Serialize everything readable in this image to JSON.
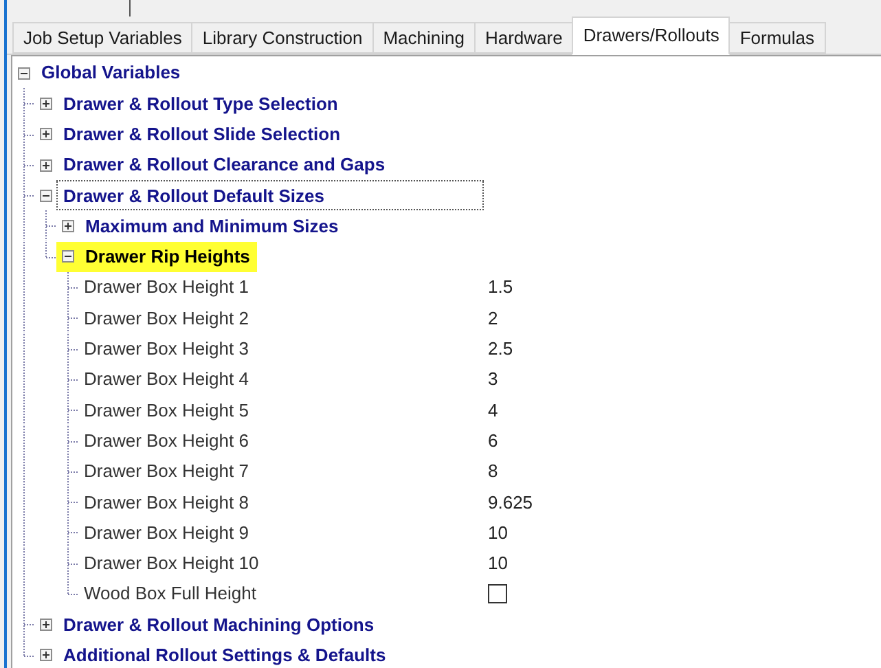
{
  "tabs": [
    {
      "label": "Job Setup Variables",
      "selected": false
    },
    {
      "label": "Library Construction",
      "selected": false
    },
    {
      "label": "Machining",
      "selected": false
    },
    {
      "label": "Hardware",
      "selected": false
    },
    {
      "label": "Drawers/Rollouts",
      "selected": true
    },
    {
      "label": "Formulas",
      "selected": false
    }
  ],
  "tree": [
    {
      "kind": "group",
      "label": "Global Variables",
      "expanded": true,
      "children": [
        {
          "kind": "group",
          "label": "Drawer & Rollout Type Selection",
          "expanded": false
        },
        {
          "kind": "group",
          "label": "Drawer & Rollout Slide Selection",
          "expanded": false
        },
        {
          "kind": "group",
          "label": "Drawer & Rollout Clearance and Gaps",
          "expanded": false
        },
        {
          "kind": "group",
          "label": "Drawer & Rollout Default Sizes",
          "expanded": true,
          "focused": true,
          "children": [
            {
              "kind": "group",
              "label": "Maximum and Minimum Sizes",
              "expanded": false
            },
            {
              "kind": "group",
              "label": "Drawer Rip Heights",
              "expanded": true,
              "highlighted": true,
              "children": [
                {
                  "kind": "value",
                  "label": "Drawer Box Height 1",
                  "value": "1.5"
                },
                {
                  "kind": "value",
                  "label": "Drawer Box Height 2",
                  "value": "2"
                },
                {
                  "kind": "value",
                  "label": "Drawer Box Height 3",
                  "value": "2.5"
                },
                {
                  "kind": "value",
                  "label": "Drawer Box Height 4",
                  "value": "3"
                },
                {
                  "kind": "value",
                  "label": "Drawer Box Height 5",
                  "value": "4"
                },
                {
                  "kind": "value",
                  "label": "Drawer Box Height 6",
                  "value": "6"
                },
                {
                  "kind": "value",
                  "label": "Drawer Box Height 7",
                  "value": "8"
                },
                {
                  "kind": "value",
                  "label": "Drawer Box Height 8",
                  "value": "9.625"
                },
                {
                  "kind": "value",
                  "label": "Drawer Box Height 9",
                  "value": "10"
                },
                {
                  "kind": "value",
                  "label": "Drawer Box Height 10",
                  "value": "10"
                },
                {
                  "kind": "checkbox",
                  "label": "Wood Box Full Height",
                  "checked": false
                }
              ]
            }
          ]
        },
        {
          "kind": "group",
          "label": "Drawer & Rollout Machining Options",
          "expanded": false
        },
        {
          "kind": "group",
          "label": "Additional Rollout Settings & Defaults",
          "expanded": false
        }
      ]
    }
  ]
}
